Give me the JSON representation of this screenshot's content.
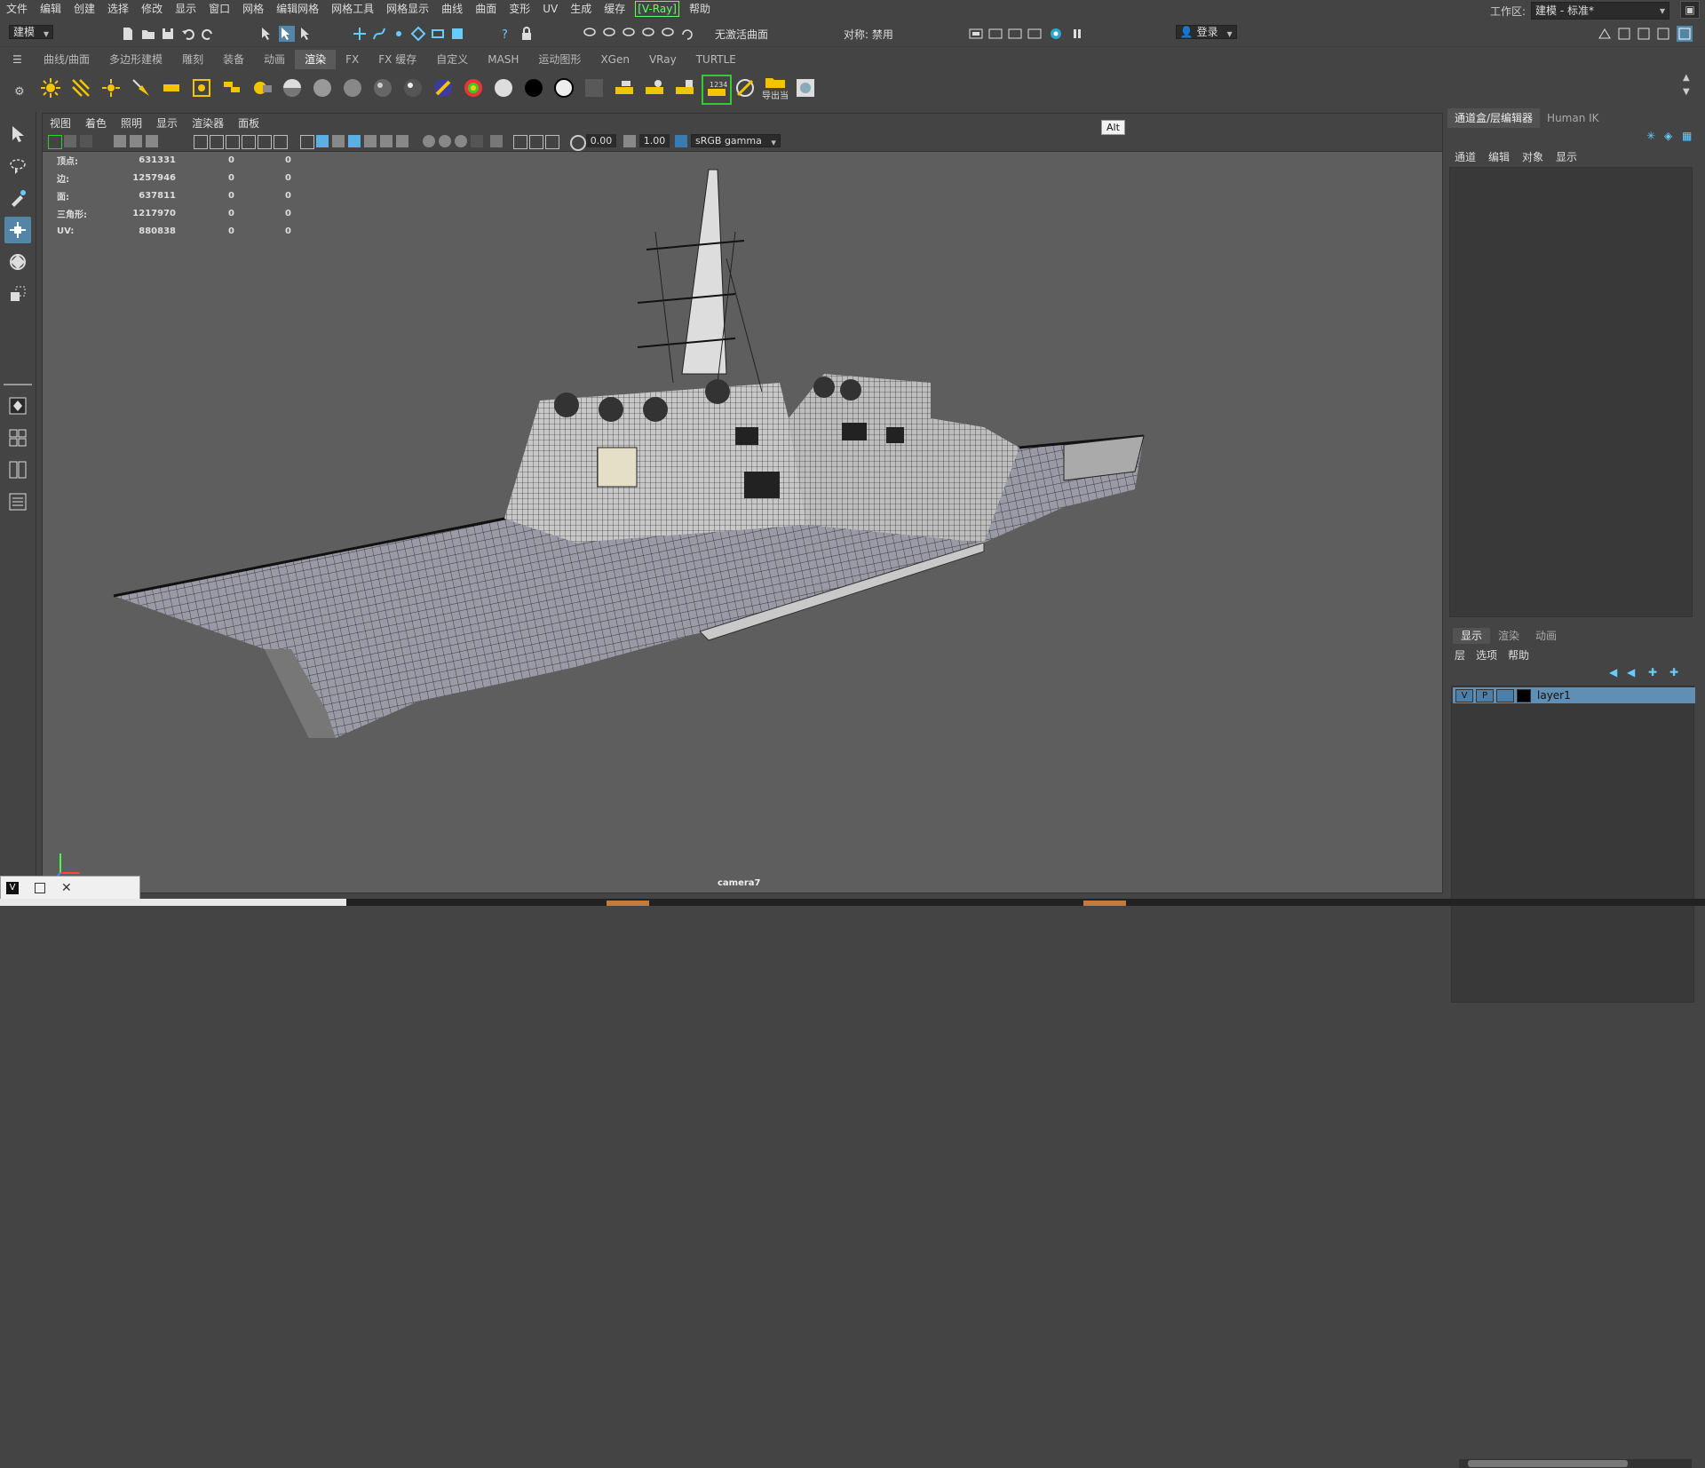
{
  "menubar": {
    "items": [
      "文件",
      "编辑",
      "创建",
      "选择",
      "修改",
      "显示",
      "窗口",
      "网格",
      "编辑网格",
      "网格工具",
      "网格显示",
      "曲线",
      "曲面",
      "变形",
      "UV",
      "生成",
      "缓存",
      "[V-Ray]",
      "帮助"
    ],
    "workspace_label": "工作区:",
    "workspace_value": "建模 - 标准*"
  },
  "statusline": {
    "mode": "建模",
    "no_live_surface": "无激活曲面",
    "symmetry": "对称: 禁用",
    "login": "登录"
  },
  "shelf": {
    "tabs": [
      "曲线/曲面",
      "多边形建模",
      "雕刻",
      "装备",
      "动画",
      "渲染",
      "FX",
      "FX 缓存",
      "自定义",
      "MASH",
      "运动图形",
      "XGen",
      "VRay",
      "TURTLE"
    ],
    "active_tab": "渲染",
    "export_label": "导出当"
  },
  "panel": {
    "menus": [
      "视图",
      "着色",
      "照明",
      "显示",
      "渲染器",
      "面板"
    ],
    "exposure": "0.00",
    "gamma": "1.00",
    "color_space": "sRGB gamma",
    "camera": "camera7"
  },
  "hud": {
    "rows": [
      {
        "label": "顶点:",
        "v1": "631331",
        "v2": "0",
        "v3": "0"
      },
      {
        "label": "边:",
        "v1": "1257946",
        "v2": "0",
        "v3": "0"
      },
      {
        "label": "面:",
        "v1": "637811",
        "v2": "0",
        "v3": "0"
      },
      {
        "label": "三角形:",
        "v1": "1217970",
        "v2": "0",
        "v3": "0"
      },
      {
        "label": "UV:",
        "v1": "880838",
        "v2": "0",
        "v3": "0"
      }
    ]
  },
  "tooltip": "Alt",
  "right_panel": {
    "tabs": [
      "通道盒/层编辑器",
      "Human IK"
    ],
    "channel_menu": [
      "通道",
      "编辑",
      "对象",
      "显示"
    ],
    "layer_tabs": [
      "显示",
      "渲染",
      "动画"
    ],
    "layer_menu": [
      "层",
      "选项",
      "帮助"
    ],
    "layer": {
      "v": "V",
      "p": "P",
      "name": "layer1"
    }
  },
  "colors": {
    "accent": "#5285a6",
    "layer_row": "#5f8fb5",
    "vray": "#66ff66"
  }
}
